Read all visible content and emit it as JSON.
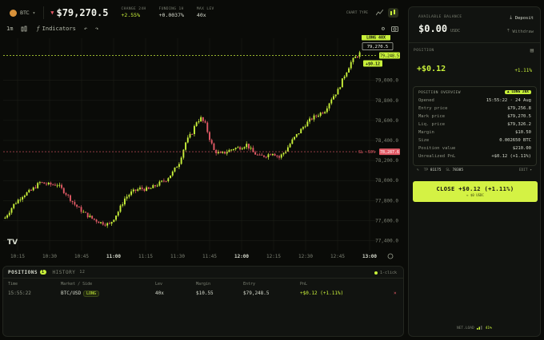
{
  "topbar": {
    "symbol": "BTC",
    "price": "$79,270.5",
    "change_label": "CHANGE 24H",
    "change_value": "+2.55%",
    "funding_label": "FUNDING 1H",
    "funding_value": "+0.0037%",
    "maxlev_label": "MAX LEV",
    "maxlev_value": "40x",
    "charttype_label": "CHART TYPE"
  },
  "toolbar": {
    "interval": "1m",
    "indicators": "Indicators"
  },
  "chart_data": {
    "type": "candlestick",
    "x_ticks": [
      "10:15",
      "10:30",
      "10:45",
      "11:00",
      "11:15",
      "11:30",
      "11:45",
      "12:00",
      "12:15",
      "12:30",
      "12:45",
      "13:00"
    ],
    "y_ticks": [
      "79,000.0",
      "78,800.0",
      "78,600.0",
      "78,400.0",
      "78,200.0",
      "78,000.0",
      "77,800.0",
      "77,600.0",
      "77,400.0"
    ],
    "ylim": [
      77300,
      79420
    ],
    "trend": [
      [
        0,
        77630
      ],
      [
        4,
        77760
      ],
      [
        8,
        77850
      ],
      [
        12,
        77900
      ],
      [
        16,
        77980
      ],
      [
        20,
        77960
      ],
      [
        24,
        77960
      ],
      [
        28,
        77870
      ],
      [
        32,
        77760
      ],
      [
        36,
        77680
      ],
      [
        40,
        77620
      ],
      [
        44,
        77580
      ],
      [
        48,
        77560
      ],
      [
        52,
        77690
      ],
      [
        55,
        77820
      ],
      [
        58,
        77880
      ],
      [
        62,
        77920
      ],
      [
        66,
        77910
      ],
      [
        70,
        77960
      ],
      [
        74,
        78010
      ],
      [
        77,
        78080
      ],
      [
        80,
        78180
      ],
      [
        83,
        78380
      ],
      [
        86,
        78480
      ],
      [
        88,
        78590
      ],
      [
        90,
        78620
      ],
      [
        92,
        78560
      ],
      [
        94,
        78420
      ],
      [
        96,
        78300
      ],
      [
        99,
        78260
      ],
      [
        102,
        78290
      ],
      [
        105,
        78320
      ],
      [
        108,
        78330
      ],
      [
        111,
        78360
      ],
      [
        114,
        78280
      ],
      [
        117,
        78240
      ],
      [
        120,
        78250
      ],
      [
        123,
        78280
      ],
      [
        126,
        78230
      ],
      [
        129,
        78300
      ],
      [
        132,
        78400
      ],
      [
        135,
        78480
      ],
      [
        138,
        78560
      ],
      [
        141,
        78620
      ],
      [
        144,
        78660
      ],
      [
        147,
        78700
      ],
      [
        150,
        78820
      ],
      [
        153,
        78900
      ],
      [
        156,
        79050
      ],
      [
        159,
        79180
      ],
      [
        161,
        79230
      ],
      [
        163,
        79270
      ]
    ],
    "long_label": "LONG 40X",
    "entry_price": "79,248.5",
    "mark_price": "79,270.5",
    "pnl_tag": "+$0.12",
    "liq_label": "SL -50%",
    "liq_price": "78,287.6",
    "entry_value": 79248.5,
    "liq_value": 78287.6
  },
  "positions": {
    "tab_positions": "POSITIONS",
    "positions_count": "1",
    "tab_history": "HISTORY",
    "history_count": "12",
    "one_click": "1-click",
    "headers": [
      "Time",
      "Market / Side",
      "Lev",
      "Margin",
      "Entry",
      "PnL"
    ],
    "rows": [
      {
        "time": "15:55:22",
        "market": "BTC/USD",
        "side": "LONG",
        "lev": "40x",
        "margin": "$10.55",
        "entry": "$79,248.5",
        "pnl": "+$0.12 (+1.11%)"
      }
    ]
  },
  "account": {
    "balance_label": "AVAILABLE BALANCE",
    "balance": "$0.00",
    "currency": "USDC",
    "deposit": "Deposit",
    "withdraw": "Withdraw",
    "position_label": "POSITION",
    "pnl": "+$0.12",
    "pnl_pct": "+1.11%",
    "overview_title": "POSITION OVERVIEW",
    "overview_badge": "LONG 20X",
    "overview": [
      {
        "k": "Opened",
        "v": "15:55:22 · 24 Aug"
      },
      {
        "k": "Entry price",
        "v": "$79,256.8"
      },
      {
        "k": "Mark price",
        "v": "$79,270.5"
      },
      {
        "k": "Liq. price",
        "v": "$79,326.2"
      },
      {
        "k": "Margin",
        "v": "$10.50"
      },
      {
        "k": "Size",
        "v": "0.002650 BTC"
      },
      {
        "k": "Position value",
        "v": "$210.00"
      },
      {
        "k": "Unrealized PnL",
        "v": "+$0.12 (+1.11%)"
      }
    ],
    "tp_label": "TP",
    "tp_value": "81175",
    "sl_label": "SL",
    "sl_value": "78385",
    "edit": "EDIT",
    "close_label": "CLOSE +$0.12 (+1.11%)",
    "close_sub": "≈ $0 USDC",
    "netload_label": "NET.LOAD",
    "netload_value": "41%"
  },
  "colors": {
    "accent": "#c8f03a",
    "down": "#e25a66",
    "up": "#c8f03a"
  }
}
